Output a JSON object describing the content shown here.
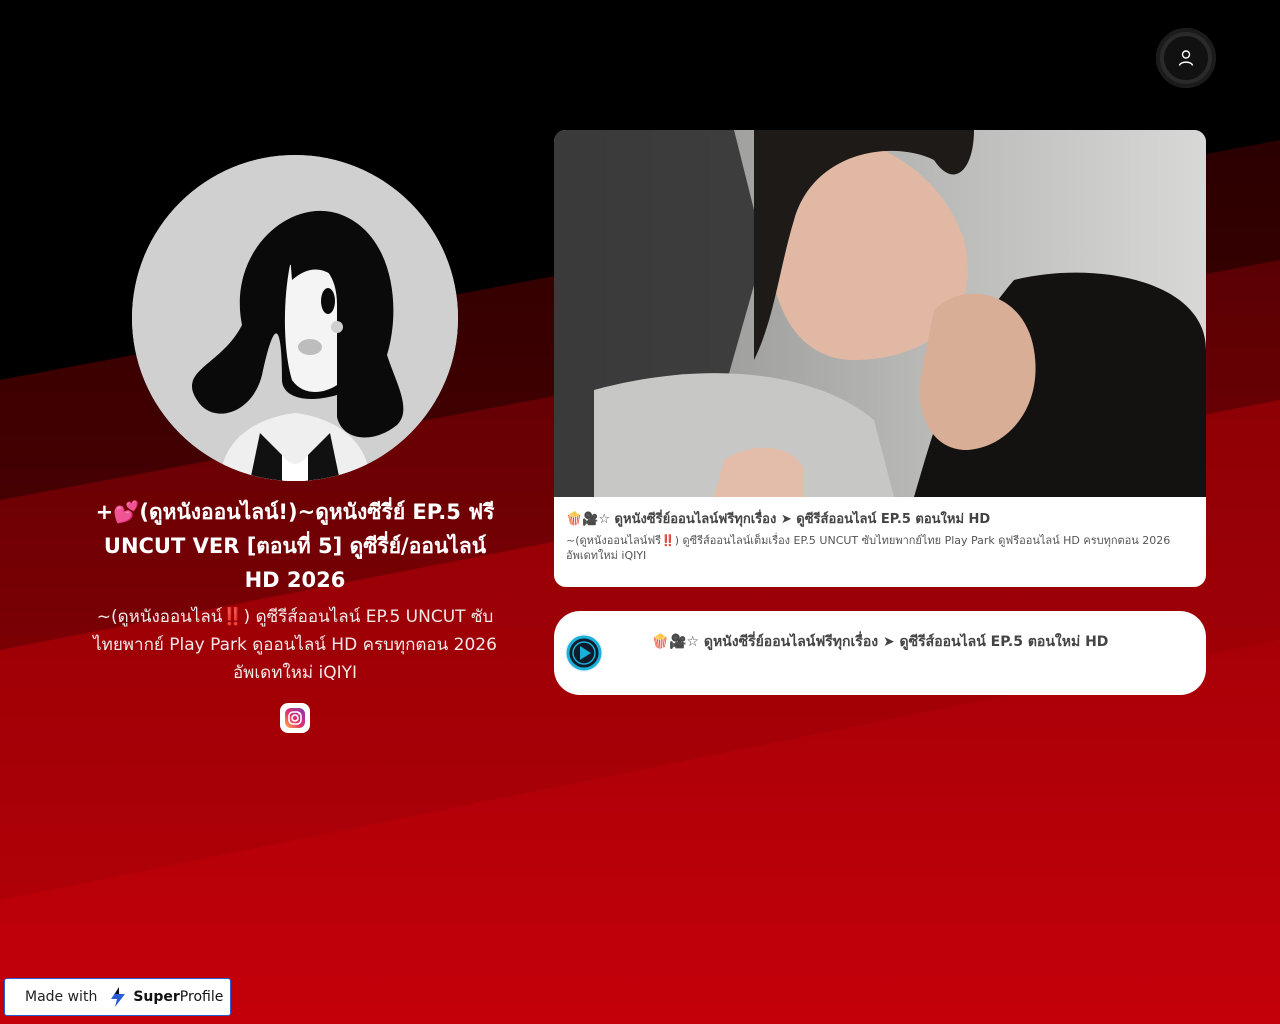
{
  "colors": {
    "background_top": "#000000",
    "background_red": "#b30005",
    "card_bg": "#ffffff",
    "play_accent": "#1ab0d8"
  },
  "header": {
    "user_icon": "user-icon"
  },
  "profile": {
    "title": "+💕(ดูหนังออนไลน์!)~ดูหนังซีรี่ย์ EP.5 ฟรี UNCUT VER [ตอนที่ 5] ดูซีรี่ย์/ออนไลน์ HD 2026",
    "description": "~(ดูหนังออนไลน์‼️) ดูซีรีส์ออนไลน์ EP.5 UNCUT ซับไทยพากย์ Play Park ดูออนไลน์ HD ครบทุกตอน 2026 อัพเดทใหม่ iQIYI",
    "instagram_icon": "instagram-icon"
  },
  "card": {
    "caption_line1": "🍿🎥☆ ดูหนังซีรี่ย์ออนไลน์ฟรีทุกเรื่อง ➤ ดูซีรีส์ออนไลน์ EP.5 ตอนใหม่ HD",
    "caption_line2": "~(ดูหนังออนไลน์ฟรี‼️) ดูซีรีส์ออนไลน์เต็มเรื่อง EP.5 UNCUT ซับไทยพากย์ไทย Play Park ดูฟรีออนไลน์ HD ครบทุกตอน 2026 อัพเดทใหม่ iQIYI"
  },
  "link_button": {
    "text": "🍿🎥☆ ดูหนังซีรี่ย์ออนไลน์ฟรีทุกเรื่อง ➤ ดูซีรีส์ออนไลน์ EP.5 ตอนใหม่ HD",
    "icon": "play-icon"
  },
  "footer": {
    "made_with": "Made with",
    "brand_bold": "Super",
    "brand_rest": "Profile"
  }
}
